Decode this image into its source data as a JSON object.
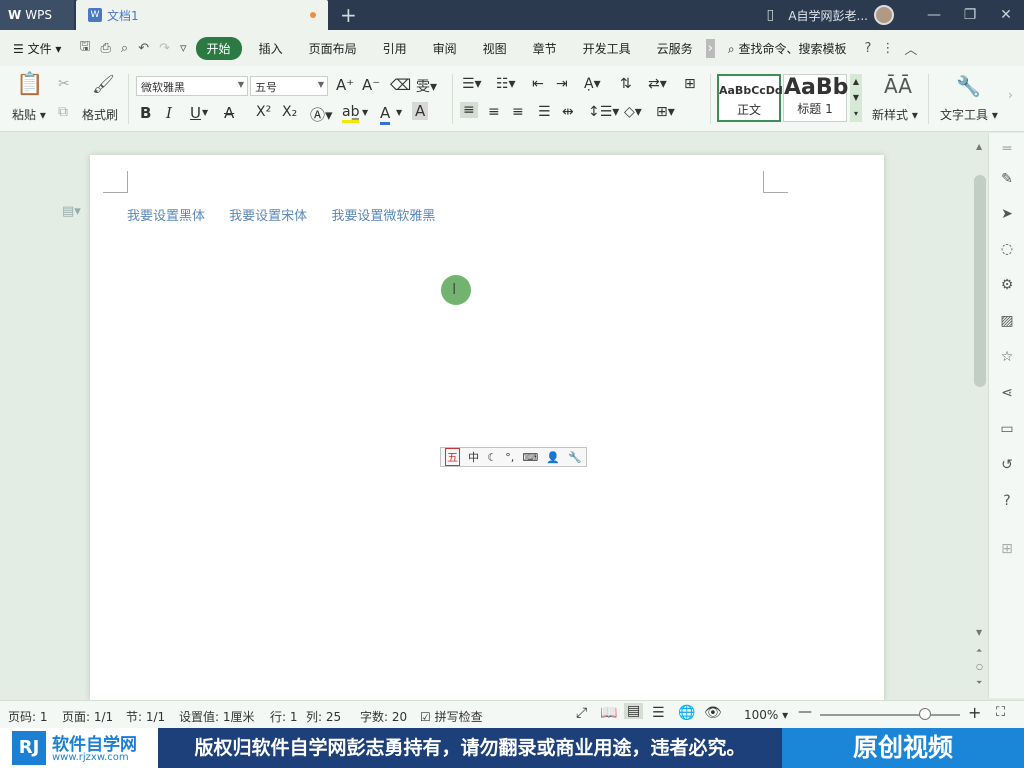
{
  "titlebar": {
    "app_tab": "WPS",
    "doc_tab": "文档1",
    "user_name": "A自学网彭老...",
    "add_tab": "+"
  },
  "menubar": {
    "file": "文件",
    "items": [
      "开始",
      "插入",
      "页面布局",
      "引用",
      "审阅",
      "视图",
      "章节",
      "开发工具",
      "云服务"
    ],
    "active": "开始",
    "search": "查找命令、搜索模板",
    "help": "?"
  },
  "ribbon": {
    "paste": "粘贴",
    "format_painter": "格式刷",
    "font_name": "微软雅黑",
    "font_size": "五号",
    "style_normal_preview": "AaBbCcDd",
    "style_normal": "正文",
    "style_heading_preview": "AaBb",
    "style_heading": "标题 1",
    "new_style": "新样式",
    "text_tools": "文字工具",
    "bold": "B",
    "italic": "I",
    "underline": "U",
    "strike": "A",
    "superscript": "X²",
    "subscript": "X₂"
  },
  "document": {
    "links": [
      "我要设置黑体",
      "我要设置宋体",
      "我要设置微软雅黑"
    ]
  },
  "ime": {
    "mode_char": "五",
    "lang": "中"
  },
  "statusbar": {
    "page_code": "页码: 1",
    "page": "页面: 1/1",
    "section": "节: 1/1",
    "setting": "设置值: 1厘米",
    "row": "行: 1",
    "col": "列: 25",
    "words": "字数: 20",
    "spellcheck": "拼写检查",
    "zoom": "100%",
    "zoom_fraction": 0.75
  },
  "banner": {
    "logo_text": "软件自学网",
    "logo_url": "www.rjzxw.com",
    "notice": "版权归软件自学网彭志勇持有，请勿翻录或商业用途，违者必究。",
    "tag": "原创视频"
  },
  "colors": {
    "accent": "#2c7a43",
    "titlebar": "#2b3a4e",
    "link": "#5b88b8",
    "banner": "#1d3f7a"
  }
}
